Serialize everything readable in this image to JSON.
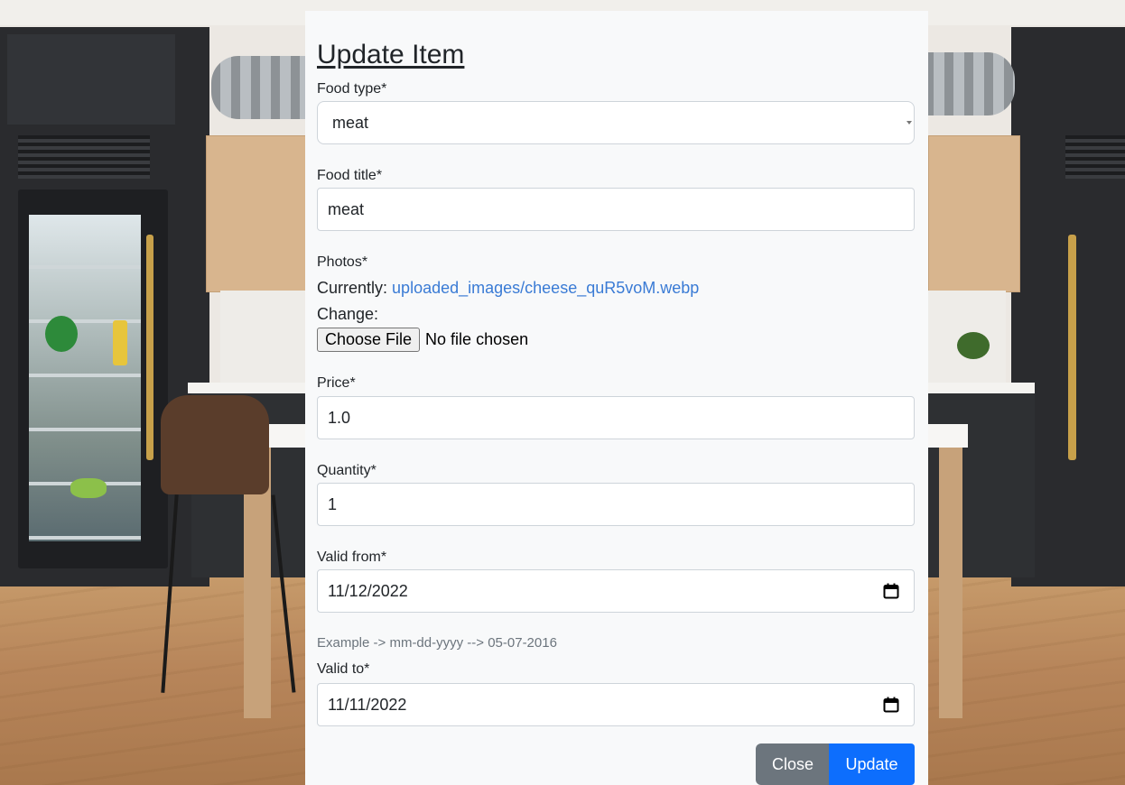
{
  "modal": {
    "title": "Update Item",
    "food_type": {
      "label": "Food type*",
      "value": "meat"
    },
    "food_title": {
      "label": "Food title*",
      "value": "meat"
    },
    "photos": {
      "label": "Photos*",
      "currently_label": "Currently:",
      "current_file": "uploaded_images/cheese_quR5voM.webp",
      "change_label": "Change:",
      "choose_button": "Choose File",
      "no_file_text": "No file chosen"
    },
    "price": {
      "label": "Price*",
      "value": "1.0"
    },
    "quantity": {
      "label": "Quantity*",
      "value": "1"
    },
    "valid_from": {
      "label": "Valid from*",
      "value": "11/12/2022"
    },
    "date_hint": "Example -> mm-dd-yyyy --> 05-07-2016",
    "valid_to": {
      "label": "Valid to*",
      "value": "11/11/2022"
    },
    "buttons": {
      "close": "Close",
      "update": "Update"
    }
  },
  "icons": {
    "calendar": "calendar-icon",
    "select_caret": "chevron-down-icon"
  },
  "colors": {
    "primary": "#0d6efd",
    "secondary": "#6c757d",
    "link": "#3a7bd5",
    "modal_bg": "#f8f9fa"
  }
}
